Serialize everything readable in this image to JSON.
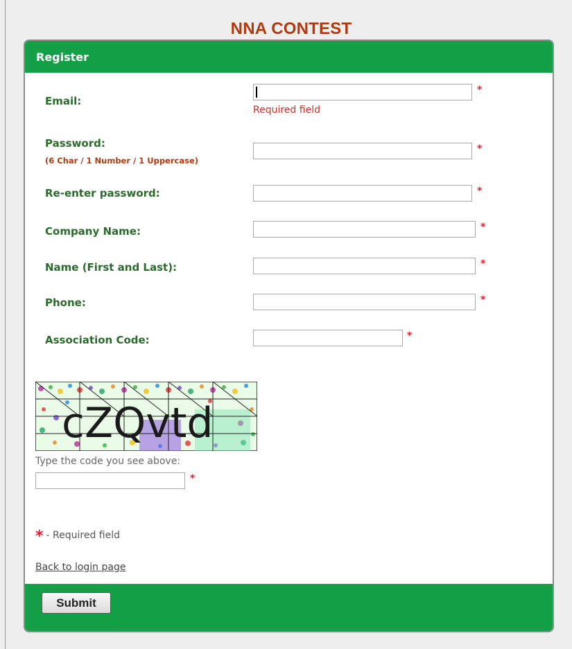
{
  "site_title": "NNA CONTEST",
  "panel_title": "Register",
  "required_star": "*",
  "fields": [
    {
      "label": "Email:",
      "value": "",
      "error": "Required field"
    },
    {
      "label": "Password:",
      "hint": "(6 Char / 1 Number / 1 Uppercase)",
      "value": ""
    },
    {
      "label": "Re-enter password:",
      "value": ""
    },
    {
      "label": "Company Name:",
      "value": ""
    },
    {
      "label": "Name (First and Last):",
      "value": ""
    },
    {
      "label": "Phone:",
      "value": ""
    },
    {
      "label": "Association Code:",
      "value": ""
    }
  ],
  "captcha": {
    "code_text": "cZQvtd",
    "prompt": "Type the code you see above:",
    "value": ""
  },
  "required_note": "- Required field",
  "back_link": "Back to login page",
  "submit_label": "Submit",
  "colors": {
    "accent_green": "#14a046",
    "title_brown": "#b03a0e",
    "label_green": "#2b6b2b",
    "required_red": "#e0202a"
  }
}
